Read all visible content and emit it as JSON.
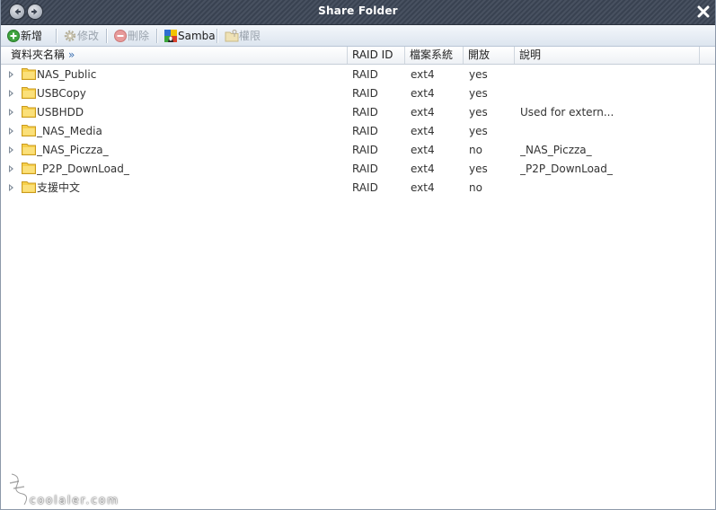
{
  "window": {
    "title": "Share Folder"
  },
  "toolbar": {
    "add_label": "新增",
    "edit_label": "修改",
    "delete_label": "刪除",
    "samba_label": "Samba",
    "permission_label": "權限"
  },
  "table": {
    "columns": [
      "資料夾名稱",
      "RAID ID",
      "檔案系統",
      "開放",
      "說明"
    ],
    "rows": [
      {
        "name": "NAS_Public",
        "raid": "RAID",
        "fs": "ext4",
        "open": "yes",
        "desc": ""
      },
      {
        "name": "USBCopy",
        "raid": "RAID",
        "fs": "ext4",
        "open": "yes",
        "desc": ""
      },
      {
        "name": "USBHDD",
        "raid": "RAID",
        "fs": "ext4",
        "open": "yes",
        "desc": "Used for extern..."
      },
      {
        "name": "_NAS_Media",
        "raid": "RAID",
        "fs": "ext4",
        "open": "yes",
        "desc": ""
      },
      {
        "name": "_NAS_Piczza_",
        "raid": "RAID",
        "fs": "ext4",
        "open": "no",
        "desc": "_NAS_Piczza_"
      },
      {
        "name": "_P2P_DownLoad_",
        "raid": "RAID",
        "fs": "ext4",
        "open": "yes",
        "desc": "_P2P_DownLoad_"
      },
      {
        "name": "支援中文",
        "raid": "RAID",
        "fs": "ext4",
        "open": "no",
        "desc": ""
      }
    ]
  },
  "watermark": {
    "text": "coolaler.com"
  },
  "colors": {
    "titlebar": "#3e4858",
    "toolbar": "#dde5ef",
    "folder": "#f4c842"
  }
}
